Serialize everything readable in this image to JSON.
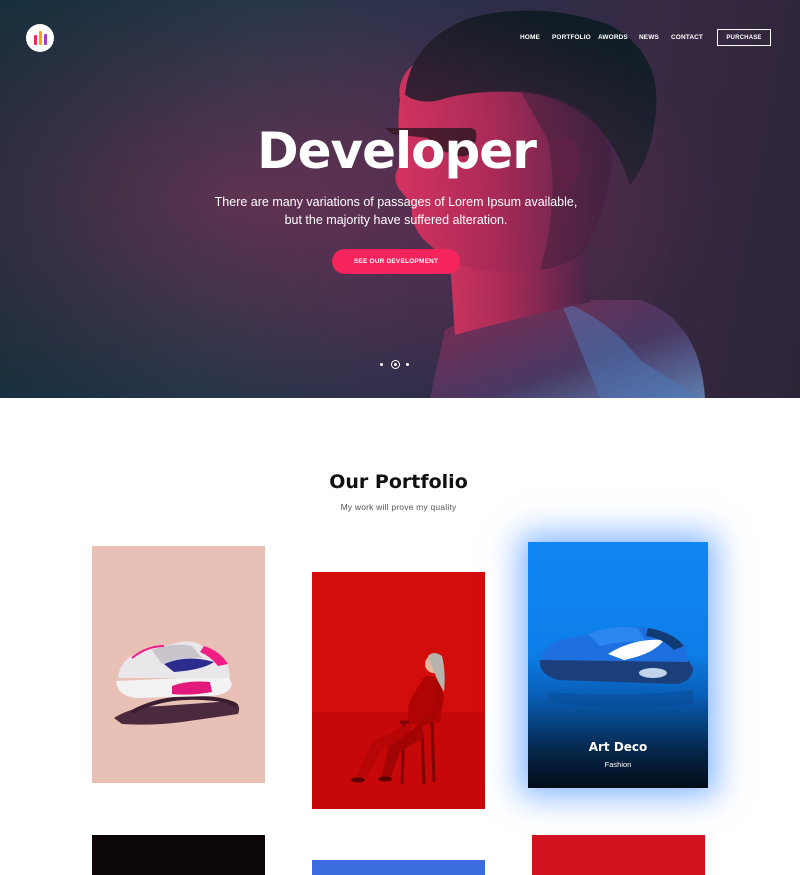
{
  "header": {
    "logo_name": "brand-logo",
    "nav": [
      {
        "label": "HOME"
      },
      {
        "label": "PORTFOLIO"
      },
      {
        "label": "AWORDS"
      },
      {
        "label": "NEWS"
      },
      {
        "label": "CONTACT"
      }
    ],
    "purchase_label": "PURCHASE"
  },
  "hero": {
    "title": "Developer",
    "subtitle_line1": "There are many variations of passages of Lorem Ipsum available,",
    "subtitle_line2": "but the majority have suffered alteration.",
    "cta_label": "SEE OUR DEVELOPMENT",
    "slider": {
      "count": 3,
      "active_index": 1
    }
  },
  "portfolio": {
    "title": "Our Portfolio",
    "subtitle": "My work will prove my quality",
    "items": [
      {
        "title": "",
        "category": ""
      },
      {
        "title": "",
        "category": ""
      },
      {
        "title": "Art Deco",
        "category": "Fashion"
      },
      {
        "title": "",
        "category": ""
      },
      {
        "title": "",
        "category": ""
      },
      {
        "title": "",
        "category": ""
      }
    ]
  },
  "colors": {
    "accent": "#f5245d",
    "hero_dark": "#16323f",
    "highlight_blue": "#0f86f5",
    "card_red": "#d30c0c",
    "card_pink": "#e8c0b5"
  }
}
